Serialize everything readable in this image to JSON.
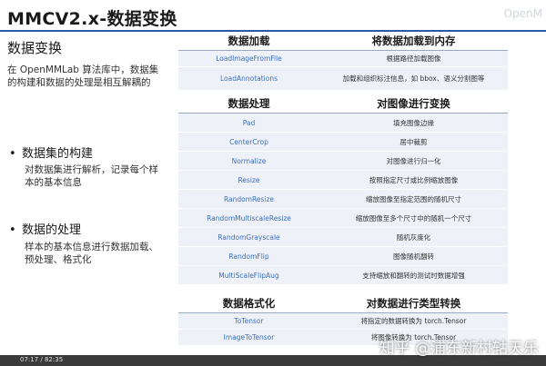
{
  "slide": {
    "title": "MMCV2.x-数据变换",
    "corner_watermark": "OpenM",
    "section_title": "数据变换",
    "intro": "在 OpenMMLab 算法库中，数据集的构建和数据的处理是相互解耦的",
    "bullets": [
      {
        "marker": "•",
        "heading": "数据集的构建",
        "desc": "对数据集进行解析，记录每个样本的基本信息"
      },
      {
        "marker": "•",
        "heading": "数据的处理",
        "desc": "样本的基本信息进行数据加载、预处理、格式化"
      }
    ]
  },
  "tables": [
    {
      "header": [
        "数据加载",
        "将数据加载到内存"
      ],
      "rows": [
        [
          "LoadImageFromFile",
          "根据路径加载图像"
        ],
        [
          "LoadAnnotations",
          "加载和组织标注信息，如 bbox、语义分割图等"
        ]
      ]
    },
    {
      "header": [
        "数据处理",
        "对图像进行变换"
      ],
      "rows": [
        [
          "Pad",
          "填充图像边缘"
        ],
        [
          "CenterCrop",
          "居中裁剪"
        ],
        [
          "Normalize",
          "对图像进行归一化"
        ],
        [
          "Resize",
          "按照指定尺寸或比例缩放图像"
        ],
        [
          "RandomResize",
          "缩放图像至指定范围的随机尺寸"
        ],
        [
          "RandomMultiscaleResize",
          "缩放图像至多个尺寸中的随机一个尺寸"
        ],
        [
          "RandomGrayscale",
          "随机灰度化"
        ],
        [
          "RandomFlip",
          "图像随机翻转"
        ],
        [
          "MultiScaleFlipAug",
          "支持缩放和翻转的测试时数据增强"
        ]
      ]
    },
    {
      "header": [
        "数据格式化",
        "对数据进行类型转换"
      ],
      "rows": [
        [
          "ToTensor",
          "将指定的数据转换为 torch.Tensor"
        ],
        [
          "ImageToTensor",
          "将图像转换为 torch.Tensor"
        ]
      ]
    }
  ],
  "player": {
    "time": "07:17 / 82:35"
  },
  "watermark": "知乎 @浦东新村轱天乐"
}
